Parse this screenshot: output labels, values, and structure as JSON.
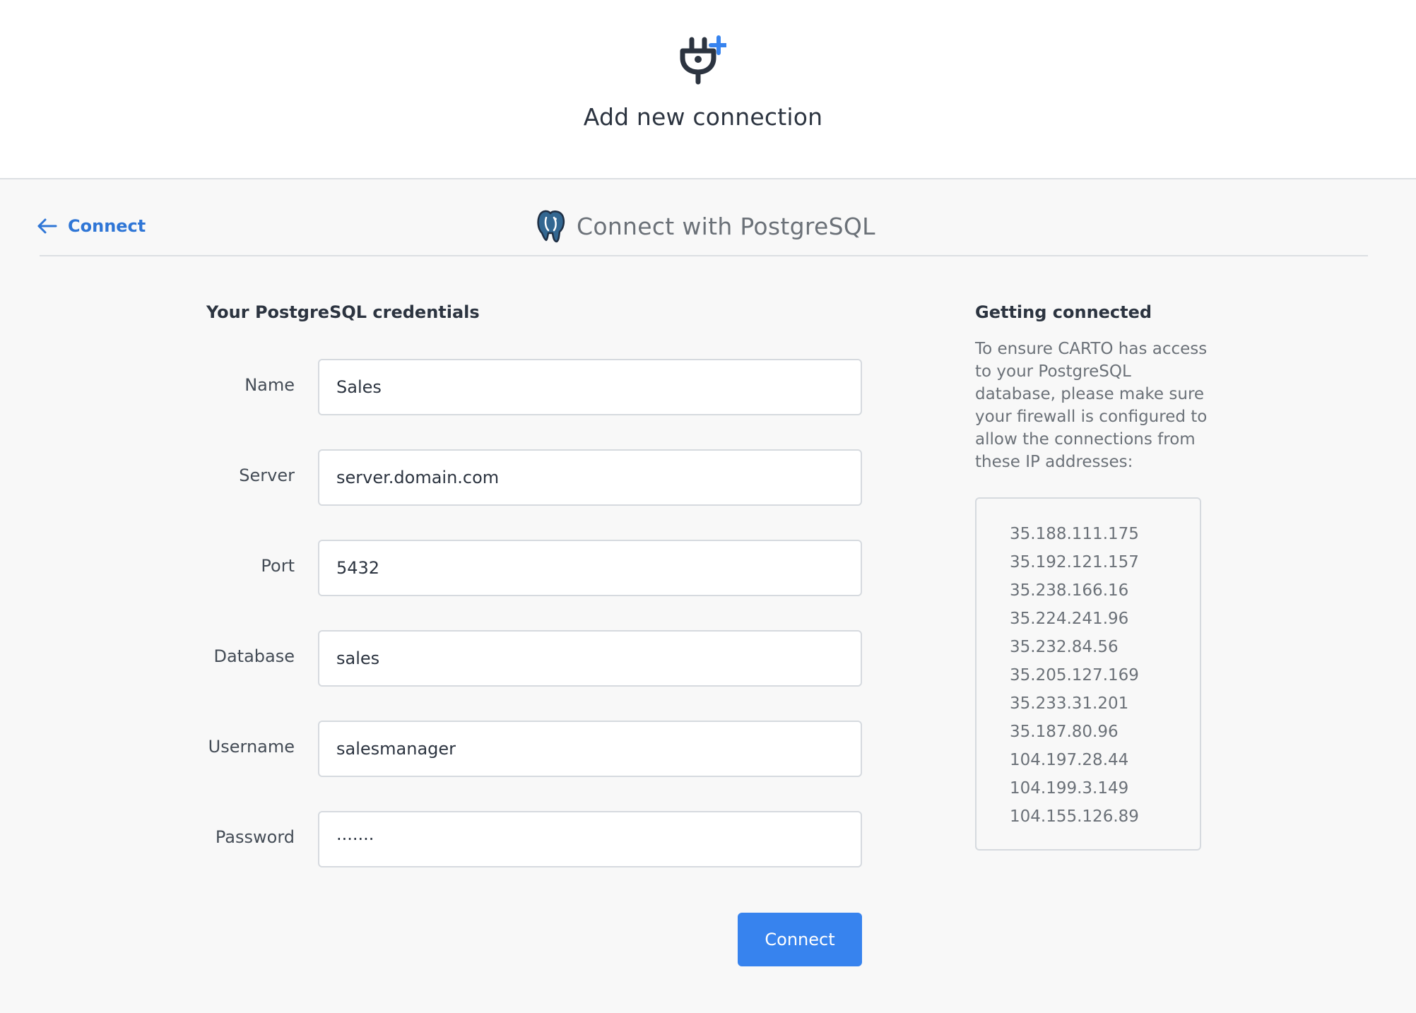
{
  "header": {
    "title": "Add new connection",
    "icon": "plug-add-icon"
  },
  "subheader": {
    "back_label": "Connect",
    "title": "Connect with PostgreSQL",
    "icon": "postgresql-elephant-icon"
  },
  "form": {
    "heading": "Your PostgreSQL credentials",
    "fields": [
      {
        "label": "Name",
        "value": "Sales"
      },
      {
        "label": "Server",
        "value": "server.domain.com"
      },
      {
        "label": "Port",
        "value": "5432"
      },
      {
        "label": "Database",
        "value": "sales"
      },
      {
        "label": "Username",
        "value": "salesmanager"
      },
      {
        "label": "Password",
        "value": "·······"
      }
    ],
    "submit_label": "Connect"
  },
  "help": {
    "heading": "Getting connected",
    "text": "To ensure CARTO has access to your PostgreSQL database, please make sure your firewall is configured to allow the connections from these IP addresses:",
    "ips": [
      "35.188.111.175",
      "35.192.121.157",
      "35.238.166.16",
      "35.224.241.96",
      "35.232.84.56",
      "35.205.127.169",
      "35.233.31.201",
      "35.187.80.96",
      "104.197.28.44",
      "104.199.3.149",
      "104.155.126.89"
    ]
  },
  "colors": {
    "accent": "#3783ee",
    "link": "#2f76d6",
    "text": "#2c3440",
    "muted": "#6b7178",
    "border": "#d6dadf",
    "background": "#f8f8f8",
    "header_background": "#ffffff"
  }
}
